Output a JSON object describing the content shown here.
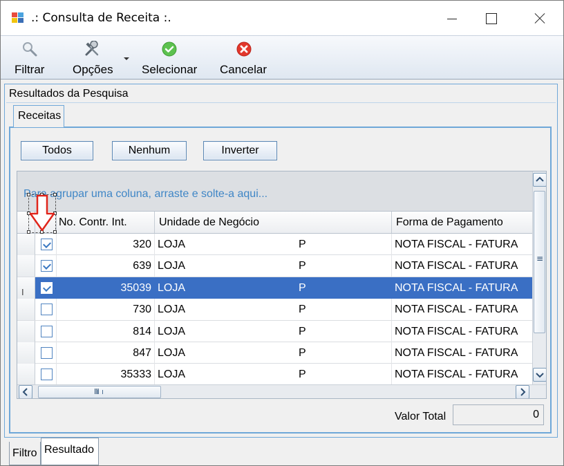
{
  "window": {
    "title": ".: Consulta de Receita :."
  },
  "toolbar": {
    "filtrar": "Filtrar",
    "opcoes": "Opções",
    "selecionar": "Selecionar",
    "cancelar": "Cancelar"
  },
  "panel": {
    "title": "Resultados da Pesquisa",
    "tab": "Receitas",
    "buttons": {
      "todos": "Todos",
      "nenhum": "Nenhum",
      "inverter": "Inverter"
    }
  },
  "grid": {
    "group_hint": "Para agrupar uma coluna, arraste e solte-a aqui...",
    "columns": {
      "no": "No. Contr. Int.",
      "unidade": "Unidade de Negócio",
      "forma": "Forma de Pagamento"
    },
    "rows": [
      {
        "checked": true,
        "no": "320",
        "unidade": "LOJA",
        "cut": "P",
        "forma": "NOTA FISCAL - FATURA"
      },
      {
        "checked": true,
        "no": "639",
        "unidade": "LOJA",
        "cut": "P",
        "forma": "NOTA FISCAL - FATURA"
      },
      {
        "checked": true,
        "no": "35039",
        "unidade": "LOJA",
        "cut": "P",
        "forma": "NOTA FISCAL - FATURA",
        "selected": true
      },
      {
        "checked": false,
        "no": "730",
        "unidade": "LOJA",
        "cut": "P",
        "forma": "NOTA FISCAL - FATURA"
      },
      {
        "checked": false,
        "no": "814",
        "unidade": "LOJA",
        "cut": "P",
        "forma": "NOTA FISCAL - FATURA"
      },
      {
        "checked": false,
        "no": "847",
        "unidade": "LOJA",
        "cut": "P",
        "forma": "NOTA FISCAL - FATURA"
      },
      {
        "checked": false,
        "no": "35333",
        "unidade": "LOJA",
        "cut": "P",
        "forma": "NOTA FISCAL - FATURA"
      }
    ],
    "row_indicator_selected": "I",
    "hscroll_grip": "III",
    "vscroll_grip": "≡"
  },
  "total": {
    "label": "Valor Total",
    "value": "0"
  },
  "bottom_tabs": {
    "filtro": "Filtro",
    "resultado": "Resultado"
  },
  "colors": {
    "selection": "#3a6fc4",
    "accent_blue": "#3f86c6",
    "border_blue": "#6ea7d8",
    "arrow_red": "#e0251b"
  },
  "icons": [
    "app-icon",
    "magnifier-icon",
    "tools-icon",
    "check-circle-icon",
    "cancel-circle-icon",
    "red-arrow-down-icon"
  ]
}
